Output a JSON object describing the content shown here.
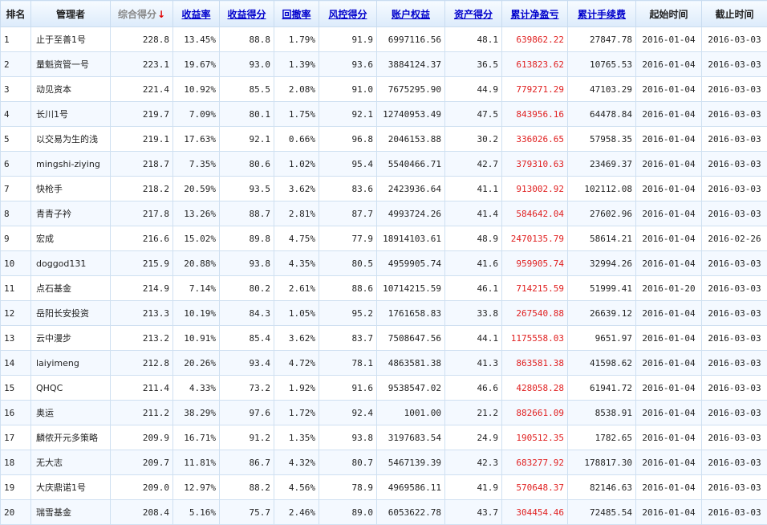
{
  "headers": [
    "排名",
    "管理者",
    "综合得分",
    "收益率",
    "收益得分",
    "回撤率",
    "风控得分",
    "账户权益",
    "资产得分",
    "累计净盈亏",
    "累计手续费",
    "起始时间",
    "截止时间"
  ],
  "sort_icon": "↓",
  "rows": [
    [
      "1",
      "止于至善1号",
      "228.8",
      "13.45%",
      "88.8",
      "1.79%",
      "91.9",
      "6997116.56",
      "48.1",
      "639862.22",
      "27847.78",
      "2016-01-04",
      "2016-03-03"
    ],
    [
      "2",
      "量魁资管一号",
      "223.1",
      "19.67%",
      "93.0",
      "1.39%",
      "93.6",
      "3884124.37",
      "36.5",
      "613823.62",
      "10765.53",
      "2016-01-04",
      "2016-03-03"
    ],
    [
      "3",
      "动见资本",
      "221.4",
      "10.92%",
      "85.5",
      "2.08%",
      "91.0",
      "7675295.90",
      "44.9",
      "779271.29",
      "47103.29",
      "2016-01-04",
      "2016-03-03"
    ],
    [
      "4",
      "长川1号",
      "219.7",
      "7.09%",
      "80.1",
      "1.75%",
      "92.1",
      "12740953.49",
      "47.5",
      "843956.16",
      "64478.84",
      "2016-01-04",
      "2016-03-03"
    ],
    [
      "5",
      "以交易为生的浅",
      "219.1",
      "17.63%",
      "92.1",
      "0.66%",
      "96.8",
      "2046153.88",
      "30.2",
      "336026.65",
      "57958.35",
      "2016-01-04",
      "2016-03-03"
    ],
    [
      "6",
      "mingshi-ziying",
      "218.7",
      "7.35%",
      "80.6",
      "1.02%",
      "95.4",
      "5540466.71",
      "42.7",
      "379310.63",
      "23469.37",
      "2016-01-04",
      "2016-03-03"
    ],
    [
      "7",
      "快枪手",
      "218.2",
      "20.59%",
      "93.5",
      "3.62%",
      "83.6",
      "2423936.64",
      "41.1",
      "913002.92",
      "102112.08",
      "2016-01-04",
      "2016-03-03"
    ],
    [
      "8",
      "青青子衿",
      "217.8",
      "13.26%",
      "88.7",
      "2.81%",
      "87.7",
      "4993724.26",
      "41.4",
      "584642.04",
      "27602.96",
      "2016-01-04",
      "2016-03-03"
    ],
    [
      "9",
      "宏成",
      "216.6",
      "15.02%",
      "89.8",
      "4.75%",
      "77.9",
      "18914103.61",
      "48.9",
      "2470135.79",
      "58614.21",
      "2016-01-04",
      "2016-02-26"
    ],
    [
      "10",
      "doggod131",
      "215.9",
      "20.88%",
      "93.8",
      "4.35%",
      "80.5",
      "4959905.74",
      "41.6",
      "959905.74",
      "32994.26",
      "2016-01-04",
      "2016-03-03"
    ],
    [
      "11",
      "点石基金",
      "214.9",
      "7.14%",
      "80.2",
      "2.61%",
      "88.6",
      "10714215.59",
      "46.1",
      "714215.59",
      "51999.41",
      "2016-01-20",
      "2016-03-03"
    ],
    [
      "12",
      "岳阳长安投资",
      "213.3",
      "10.19%",
      "84.3",
      "1.05%",
      "95.2",
      "1761658.83",
      "33.8",
      "267540.88",
      "26639.12",
      "2016-01-04",
      "2016-03-03"
    ],
    [
      "13",
      "云中漫步",
      "213.2",
      "10.91%",
      "85.4",
      "3.62%",
      "83.7",
      "7508647.56",
      "44.1",
      "1175558.03",
      "9651.97",
      "2016-01-04",
      "2016-03-03"
    ],
    [
      "14",
      "laiyimeng",
      "212.8",
      "20.26%",
      "93.4",
      "4.72%",
      "78.1",
      "4863581.38",
      "41.3",
      "863581.38",
      "41598.62",
      "2016-01-04",
      "2016-03-03"
    ],
    [
      "15",
      "QHQC",
      "211.4",
      "4.33%",
      "73.2",
      "1.92%",
      "91.6",
      "9538547.02",
      "46.6",
      "428058.28",
      "61941.72",
      "2016-01-04",
      "2016-03-03"
    ],
    [
      "16",
      "奥运",
      "211.2",
      "38.29%",
      "97.6",
      "1.72%",
      "92.4",
      "1001.00",
      "21.2",
      "882661.09",
      "8538.91",
      "2016-01-04",
      "2016-03-03"
    ],
    [
      "17",
      "麟侬开元多策略",
      "209.9",
      "16.71%",
      "91.2",
      "1.35%",
      "93.8",
      "3197683.54",
      "24.9",
      "190512.35",
      "1782.65",
      "2016-01-04",
      "2016-03-03"
    ],
    [
      "18",
      "无大志",
      "209.7",
      "11.81%",
      "86.7",
      "4.32%",
      "80.7",
      "5467139.39",
      "42.3",
      "683277.92",
      "178817.30",
      "2016-01-04",
      "2016-03-03"
    ],
    [
      "19",
      "大庆鼎诺1号",
      "209.0",
      "12.97%",
      "88.2",
      "4.56%",
      "78.9",
      "4969586.11",
      "41.9",
      "570648.37",
      "82146.63",
      "2016-01-04",
      "2016-03-03"
    ],
    [
      "20",
      "瑞雪基金",
      "208.4",
      "5.16%",
      "75.7",
      "2.46%",
      "89.0",
      "6053622.78",
      "43.7",
      "304454.46",
      "72485.54",
      "2016-01-04",
      "2016-03-03"
    ]
  ],
  "colors": {
    "header_link": "#0000cc",
    "header_gray": "#888888",
    "profit_red": "#e02020",
    "sort_arrow": "#e00000"
  }
}
